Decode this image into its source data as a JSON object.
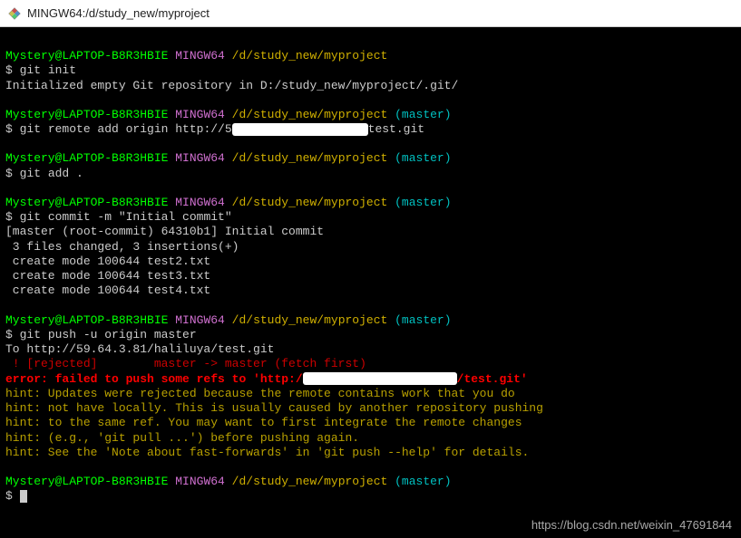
{
  "titlebar": {
    "title": "MINGW64:/d/study_new/myproject"
  },
  "prompt": {
    "user": "Mystery@LAPTOP-B8R3HBIE",
    "mingw": "MINGW64",
    "path": "/d/study_new/myproject",
    "branch": "(master)",
    "dollar": "$ "
  },
  "cmd": {
    "init": "git init",
    "remote_pre": "git remote add origin http://5",
    "remote_post": "test.git",
    "add": "git add .",
    "commit": "git commit -m \"Initial commit\"",
    "push": "git push -u origin master"
  },
  "out": {
    "init": "Initialized empty Git repository in D:/study_new/myproject/.git/",
    "commit1": "[master (root-commit) 64310b1] Initial commit",
    "commit2": " 3 files changed, 3 insertions(+)",
    "commit3": " create mode 100644 test2.txt",
    "commit4": " create mode 100644 test3.txt",
    "commit5": " create mode 100644 test4.txt",
    "push_to": "To http://59.64.3.81/haliluya/test.git",
    "rejected": " ! [rejected]        master -> master (fetch first)",
    "error_pre": "error: failed to push some refs to 'http:/",
    "error_post": "/test.git'",
    "hint1": "hint: Updates were rejected because the remote contains work that you do",
    "hint2": "hint: not have locally. This is usually caused by another repository pushing",
    "hint3": "hint: to the same ref. You may want to first integrate the remote changes",
    "hint4": "hint: (e.g., 'git pull ...') before pushing again.",
    "hint5": "hint: See the 'Note about fast-forwards' in 'git push --help' for details."
  },
  "watermark": "https://blog.csdn.net/weixin_47691844"
}
